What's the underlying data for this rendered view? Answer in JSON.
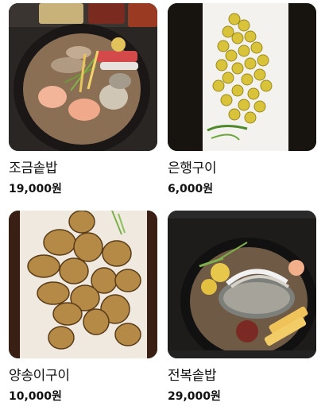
{
  "menu": {
    "items": [
      {
        "name": "조금솥밥",
        "price": "19,000원",
        "image": "clam-pot-rice-photo"
      },
      {
        "name": "은행구이",
        "price": "6,000원",
        "image": "roasted-ginkgo-photo"
      },
      {
        "name": "양송이구이",
        "price": "10,000원",
        "image": "grilled-mushroom-photo"
      },
      {
        "name": "전복솥밥",
        "price": "29,000원",
        "image": "abalone-pot-rice-photo"
      }
    ]
  }
}
